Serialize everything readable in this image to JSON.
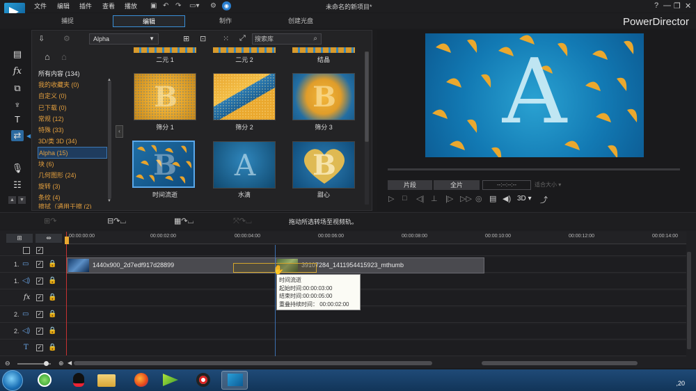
{
  "window": {
    "title": "未命名的新项目*",
    "brand": "PowerDirector",
    "menu": [
      "文件",
      "编辑",
      "插件",
      "查看",
      "播放"
    ],
    "controls": [
      "?",
      "—",
      "❐",
      "✕"
    ]
  },
  "modes": {
    "capture": "捕捉",
    "edit": "编辑",
    "produce": "制作",
    "disc": "创建光盘"
  },
  "library": {
    "dropdown_value": "Alpha",
    "search_placeholder": "搜索库",
    "categories": [
      {
        "label": "所有内容 (134)"
      },
      {
        "label": "我的收藏夹 (0)"
      },
      {
        "label": "自定义 (0)"
      },
      {
        "label": "已下载 (0)"
      },
      {
        "label": "常规 (12)"
      },
      {
        "label": "特殊 (33)"
      },
      {
        "label": "3D/类 3D (34)"
      },
      {
        "label": "Alpha (15)"
      },
      {
        "label": "块 (6)"
      },
      {
        "label": "几何图形 (24)"
      },
      {
        "label": "旋转 (3)"
      },
      {
        "label": "条纹 (4)"
      },
      {
        "label": "擦拭（通用于擦 (2)"
      }
    ],
    "top_row": [
      "二元 1",
      "二元 2",
      "结晶"
    ],
    "items": [
      {
        "label": "筛分 1"
      },
      {
        "label": "筛分 2"
      },
      {
        "label": "筛分 3"
      },
      {
        "label": "时间流逝"
      },
      {
        "label": "水滴"
      },
      {
        "label": "甜心"
      }
    ]
  },
  "preview": {
    "clip_btn": "片段",
    "full_btn": "全片",
    "timecode": "--:--:--:--",
    "fit": "适合大小",
    "mode3d": "3D"
  },
  "midbar": {
    "hint": "拖动所选转场至视频轨。"
  },
  "ruler": [
    "00:00:00:00",
    "00:00:02:00",
    "00:00:04:00",
    "00:00:06:00",
    "00:00:08:00",
    "00:00:10:00",
    "00:00:12:00",
    "00:00:14:00"
  ],
  "tracks": [
    {
      "num": "1.",
      "icon": "video-icon"
    },
    {
      "num": "1.",
      "icon": "audio-icon"
    },
    {
      "num": "",
      "icon": "fx-icon"
    },
    {
      "num": "2.",
      "icon": "video-icon"
    },
    {
      "num": "2.",
      "icon": "audio-icon"
    },
    {
      "num": "",
      "icon": "title-icon"
    }
  ],
  "clips": {
    "clip1": "1440x900_2d7edf917d28899",
    "clip2": "39107284_1411954415923_mthumb"
  },
  "tooltip": {
    "name": "时间流逝",
    "start": "起始时间:00:00:03:00",
    "end": "结束时间:00:00:05:00",
    "overlap": "重叠持续时间：  00:00:02:00"
  },
  "taskbar": {
    "clock": ",20"
  },
  "colors": {
    "accent": "#3a8fd8",
    "category": "#e39f3e",
    "playhead": "#c83232"
  }
}
